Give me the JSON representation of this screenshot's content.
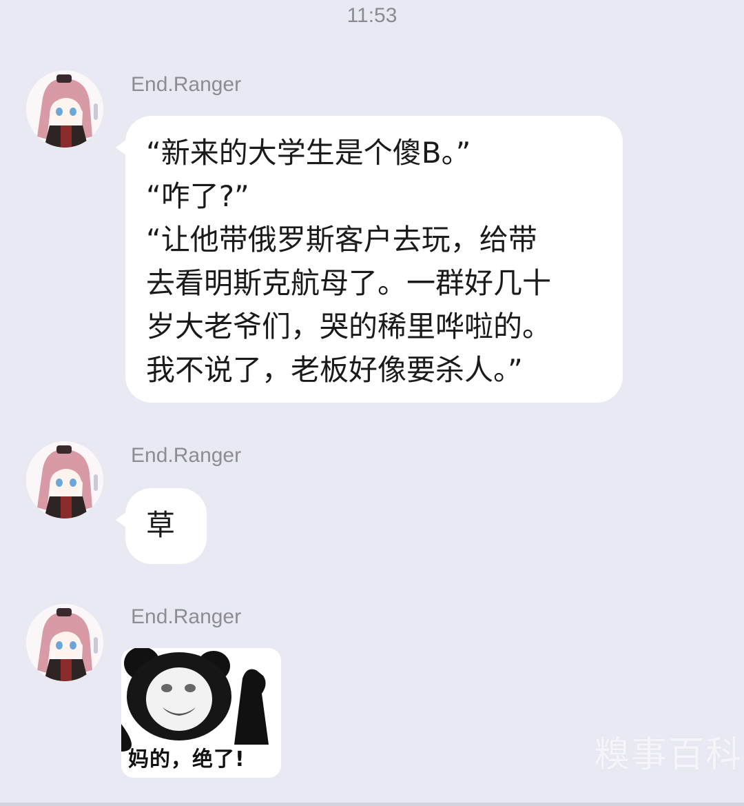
{
  "status_time": "11:53",
  "messages": [
    {
      "sender": "End.Ranger",
      "avatar_icon": "anime-girl-avatar",
      "text": "“新来的大学生是个傻B。”\n“咋了?”\n“让他带俄罗斯客户去玩，给带\n去看明斯克航母了。一群好几十\n岁大老爷们，哭的稀里哗啦的。\n我不说了，老板好像要杀人。”"
    },
    {
      "sender": "End.Ranger",
      "avatar_icon": "anime-girl-avatar",
      "text": "草"
    },
    {
      "sender": "End.Ranger",
      "avatar_icon": "anime-girl-avatar",
      "sticker_icon": "panda-meme-sticker",
      "sticker_caption": "妈的，绝了!"
    }
  ],
  "watermark": "糗事百科",
  "colors": {
    "background": "#e9e9f3",
    "bubble": "#ffffff",
    "sender_name": "#8c8c92",
    "timestamp": "#8a8a90"
  }
}
